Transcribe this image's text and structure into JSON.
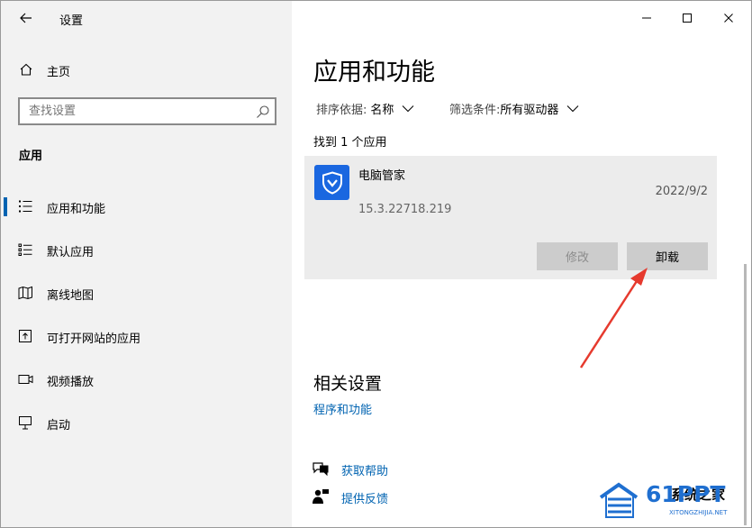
{
  "window": {
    "title": "设置"
  },
  "sidebar": {
    "home_label": "主页",
    "search": {
      "placeholder": "查找设置"
    },
    "section_heading": "应用",
    "items": [
      {
        "label": "应用和功能",
        "icon": "apps-features-icon",
        "active": true
      },
      {
        "label": "默认应用",
        "icon": "default-apps-icon",
        "active": false
      },
      {
        "label": "离线地图",
        "icon": "offline-maps-icon",
        "active": false
      },
      {
        "label": "可打开网站的应用",
        "icon": "apps-for-websites-icon",
        "active": false
      },
      {
        "label": "视频播放",
        "icon": "video-playback-icon",
        "active": false
      },
      {
        "label": "启动",
        "icon": "startup-icon",
        "active": false
      }
    ]
  },
  "main": {
    "title": "应用和功能",
    "sort": {
      "label": "排序依据:",
      "value": "名称"
    },
    "filter": {
      "label": "筛选条件:",
      "value": "所有驱动器"
    },
    "found_count": "找到 1 个应用",
    "app": {
      "name": "电脑管家",
      "date": "2022/9/2",
      "version": "15.3.22718.219",
      "modify_label": "修改",
      "uninstall_label": "卸载"
    },
    "related": {
      "title": "相关设置",
      "programs_link": "程序和功能"
    },
    "help": {
      "get_help": "获取帮助",
      "feedback": "提供反馈"
    }
  },
  "watermark": {
    "text": "61PPT",
    "sub": "XITONGZHIJIA.NET",
    "behind_text": "系统之家"
  },
  "colors": {
    "accent": "#0063b1",
    "sidebar_bg": "#f2f2f2",
    "card_bg": "#ececec",
    "annotation_arrow": "#e63a2e"
  }
}
